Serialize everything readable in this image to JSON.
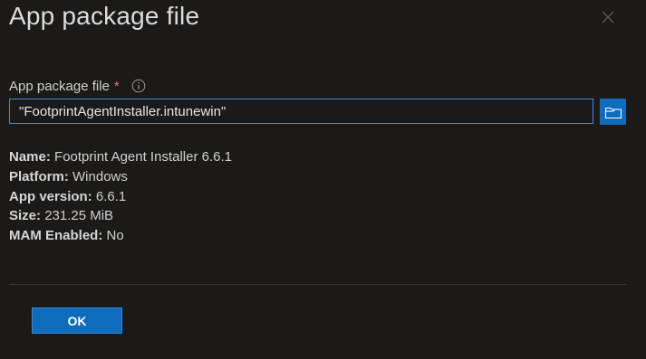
{
  "dialog": {
    "title": "App package file",
    "close_icon": "close-icon"
  },
  "field": {
    "label": "App package file",
    "required_mark": "*",
    "info_icon": "info-icon",
    "value": "\"FootprintAgentInstaller.intunewin\"",
    "browse_icon": "folder-icon"
  },
  "details": [
    {
      "key": "Name:",
      "value": "Footprint Agent Installer 6.6.1"
    },
    {
      "key": "Platform:",
      "value": "Windows"
    },
    {
      "key": "App version:",
      "value": "6.6.1"
    },
    {
      "key": "Size:",
      "value": "231.25 MiB"
    },
    {
      "key": "MAM Enabled:",
      "value": "No"
    }
  ],
  "footer": {
    "ok_label": "OK"
  },
  "colors": {
    "background": "#1b1a19",
    "accent": "#0f6cbd",
    "input_border": "#3c8ede",
    "required": "#f1707b",
    "divider": "#3b3a39"
  }
}
